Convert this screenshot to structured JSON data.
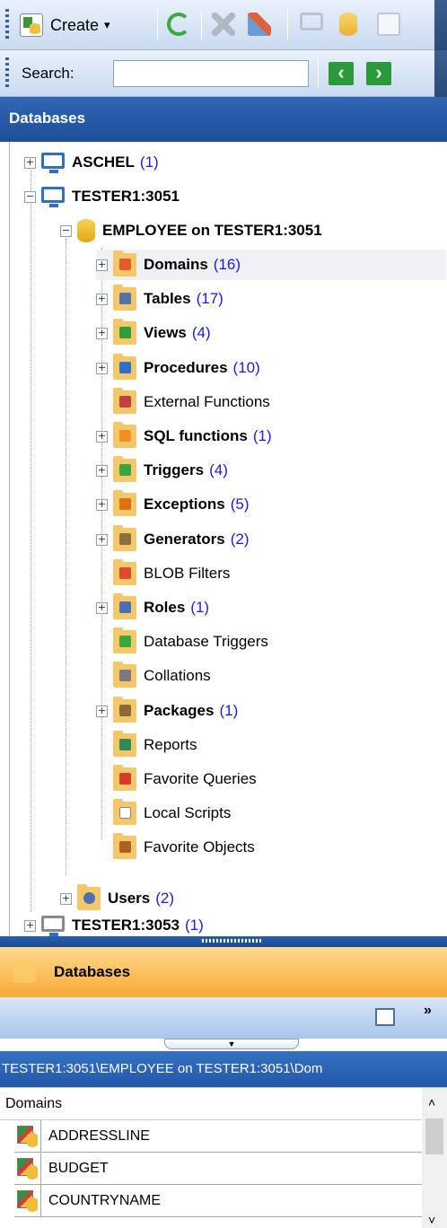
{
  "toolbar": {
    "create_label": "Create",
    "create_arrow": "▾",
    "icons": [
      "create-icon",
      "refresh-icon",
      "disconnect-icon",
      "connect-icon",
      "server-icon",
      "database-edit-icon",
      "properties-icon"
    ]
  },
  "search": {
    "label": "Search:",
    "value": "",
    "prev": "‹",
    "next": "›"
  },
  "explorer": {
    "title": "Databases",
    "servers": [
      {
        "name": "ASCHEL",
        "count": "(1)"
      },
      {
        "name": "TESTER1:3051",
        "count": ""
      },
      {
        "name": "TESTER1:3053",
        "count": "(1)"
      }
    ],
    "database": "EMPLOYEE on TESTER1:3051",
    "nodes": [
      {
        "label": "Domains",
        "count": "(16)",
        "bold": true,
        "expandable": true,
        "color": "#e05c2a"
      },
      {
        "label": "Tables",
        "count": "(17)",
        "bold": true,
        "expandable": true,
        "color": "#5470a8"
      },
      {
        "label": "Views",
        "count": "(4)",
        "bold": true,
        "expandable": true,
        "color": "#2f9c3a"
      },
      {
        "label": "Procedures",
        "count": "(10)",
        "bold": true,
        "expandable": true,
        "color": "#2f6fc9"
      },
      {
        "label": "External Functions",
        "count": "",
        "bold": false,
        "expandable": false,
        "color": "#c04040"
      },
      {
        "label": "SQL functions",
        "count": "(1)",
        "bold": true,
        "expandable": true,
        "color": "#f09020"
      },
      {
        "label": "Triggers",
        "count": "(4)",
        "bold": true,
        "expandable": true,
        "color": "#3aa63a"
      },
      {
        "label": "Exceptions",
        "count": "(5)",
        "bold": true,
        "expandable": true,
        "color": "#e07010"
      },
      {
        "label": "Generators",
        "count": "(2)",
        "bold": true,
        "expandable": true,
        "color": "#8a7040"
      },
      {
        "label": "BLOB Filters",
        "count": "",
        "bold": false,
        "expandable": false,
        "color": "#e04a2a"
      },
      {
        "label": "Roles",
        "count": "(1)",
        "bold": true,
        "expandable": true,
        "color": "#4a70b0"
      },
      {
        "label": "Database Triggers",
        "count": "",
        "bold": false,
        "expandable": false,
        "color": "#3aa63a"
      },
      {
        "label": "Collations",
        "count": "",
        "bold": false,
        "expandable": false,
        "color": "#7a7a7a"
      },
      {
        "label": "Packages",
        "count": "(1)",
        "bold": true,
        "expandable": true,
        "color": "#8a6a3a"
      },
      {
        "label": "Reports",
        "count": "",
        "bold": false,
        "expandable": false,
        "color": "#2f8a5a"
      },
      {
        "label": "Favorite Queries",
        "count": "",
        "bold": false,
        "expandable": false,
        "color": "#d83a2a"
      },
      {
        "label": "Local Scripts",
        "count": "",
        "bold": false,
        "expandable": false,
        "color": "#ffffff"
      },
      {
        "label": "Favorite Objects",
        "count": "",
        "bold": false,
        "expandable": false,
        "color": "#b06020"
      }
    ],
    "users": {
      "label": "Users",
      "count": "(2)"
    }
  },
  "object_browser": {
    "title": "Databases",
    "more": "»",
    "path": "TESTER1:3051\\EMPLOYEE on TESTER1:3051\\Dom",
    "column_header": "Domains",
    "rows": [
      "ADDRESSLINE",
      "BUDGET",
      "COUNTRYNAME"
    ]
  }
}
